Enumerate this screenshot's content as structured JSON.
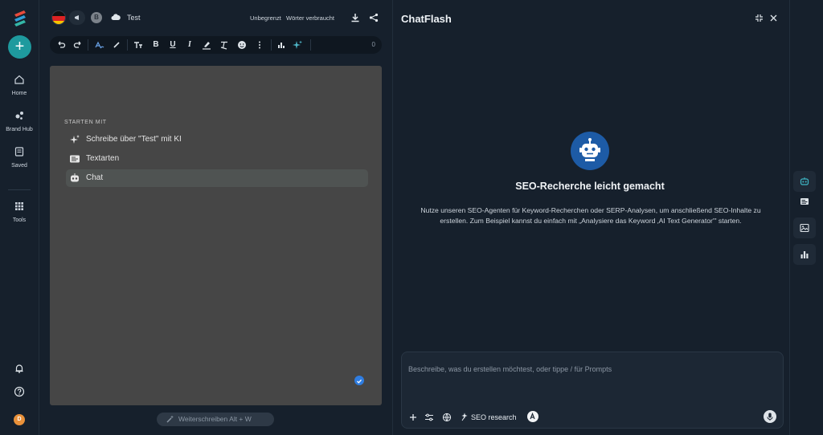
{
  "sidebar": {
    "new_label": "+",
    "items": [
      {
        "label": "Home",
        "icon": "home-icon"
      },
      {
        "label": "Brand Hub",
        "icon": "brand-hub-icon"
      },
      {
        "label": "Saved",
        "icon": "saved-icon"
      },
      {
        "label": "Tools",
        "icon": "tools-icon"
      }
    ],
    "user_initial": "D"
  },
  "editor": {
    "avatar_initial": "B",
    "doc_title": "Test",
    "unlimited": "Unbegrenzt",
    "words_used": "Wörter verbraucht",
    "word_count": "0",
    "start_label": "STARTEN MIT",
    "options": [
      {
        "label": "Schreibe über \"Test\" mit KI",
        "icon": "sparkle-icon"
      },
      {
        "label": "Textarten",
        "icon": "text-types-icon"
      },
      {
        "label": "Chat",
        "icon": "robot-icon"
      }
    ],
    "continue_label": "Weiterschreiben Alt + W"
  },
  "chat": {
    "title": "ChatFlash",
    "hero_title": "SEO-Recherche leicht gemacht",
    "hero_text": "Nutze unseren SEO-Agenten für Keyword-Recherchen oder SERP-Analysen, um anschließend SEO-Inhalte zu erstellen. Zum Beispiel kannst du einfach mit „Analysiere das Keyword ‚AI Text Generator'\" starten.",
    "prompt_placeholder": "Beschreibe, was du erstellen möchtest, oder tippe / für Prompts",
    "seo_button": "SEO research"
  },
  "colors": {
    "accent": "#1e9a9e",
    "robot_bg": "#1d5ba6",
    "canvas": "#464646",
    "background": "#16202c"
  }
}
